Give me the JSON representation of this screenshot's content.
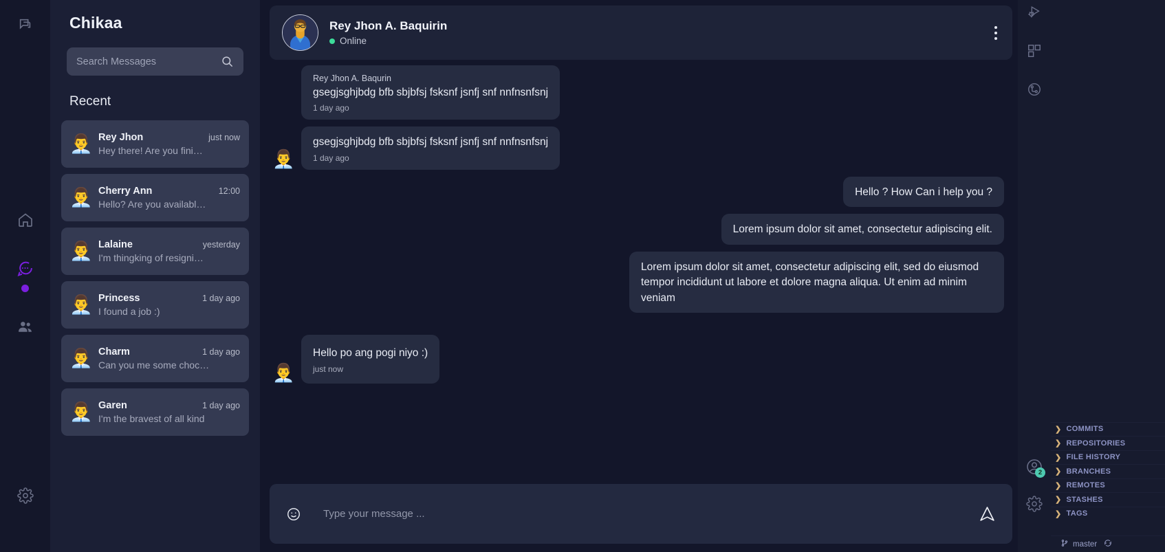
{
  "app": {
    "brand": "Chikaa"
  },
  "rail": {
    "items": [
      {
        "name": "messages-rail-icon",
        "label": "Messages"
      },
      {
        "name": "home-rail-icon",
        "label": "Home"
      },
      {
        "name": "chat-rail-icon",
        "label": "Chat"
      },
      {
        "name": "contacts-rail-icon",
        "label": "Contacts"
      },
      {
        "name": "settings-rail-icon",
        "label": "Settings"
      }
    ]
  },
  "search": {
    "placeholder": "Search Messages",
    "value": ""
  },
  "sidebar": {
    "section_title": "Recent",
    "chats": [
      {
        "name": "Rey Jhon",
        "time": "just now",
        "preview": "Hey there! Are you fini…",
        "avatar": "👨‍💼"
      },
      {
        "name": "Cherry Ann",
        "time": "12:00",
        "preview": "Hello? Are you availabl…",
        "avatar": "👨‍💼"
      },
      {
        "name": "Lalaine",
        "time": "yesterday",
        "preview": "I'm thingking of resigni…",
        "avatar": "👨‍💼"
      },
      {
        "name": "Princess",
        "time": "1 day ago",
        "preview": "I found a job :)",
        "avatar": "👨‍💼"
      },
      {
        "name": "Charm",
        "time": "1 day ago",
        "preview": "Can you me some choc…",
        "avatar": "👨‍💼"
      },
      {
        "name": "Garen",
        "time": "1 day ago",
        "preview": "I'm the bravest of all kind",
        "avatar": "👨‍💼"
      }
    ]
  },
  "conversation": {
    "header": {
      "name": "Rey Jhon A. Baquirin",
      "status": "Online",
      "status_color": "#3ddc9a"
    },
    "messages": [
      {
        "side": "in",
        "sender": "Rey Jhon A. Baqurin",
        "text": "gsegjsghjbdg bfb sbjbfsj fsksnf jsnfj snf nnfnsnfsnj",
        "time": "1 day ago",
        "show_avatar": false
      },
      {
        "side": "in",
        "sender": "",
        "text": "gsegjsghjbdg bfb sbjbfsj fsksnf jsnfj snf nnfnsnfsnj",
        "time": "1 day ago",
        "show_avatar": true
      },
      {
        "side": "out",
        "sender": "",
        "text": "Hello ? How Can i help you ?",
        "time": "",
        "show_avatar": false
      },
      {
        "side": "out",
        "sender": "",
        "text": "Lorem ipsum dolor sit amet, consectetur adipiscing elit.",
        "time": "",
        "show_avatar": false
      },
      {
        "side": "out",
        "sender": "",
        "text": "Lorem ipsum dolor sit amet, consectetur adipiscing elit, sed do eiusmod tempor incididunt ut labore et dolore magna aliqua. Ut enim ad minim veniam",
        "time": "",
        "show_avatar": false
      },
      {
        "side": "in",
        "sender": "",
        "text": "Hello po ang pogi niyo :)",
        "time": "just now",
        "show_avatar": true
      }
    ]
  },
  "composer": {
    "placeholder": "Type your message ...",
    "value": ""
  },
  "ide": {
    "activity_icons": [
      "run-and-debug-icon",
      "extensions-icon",
      "source-control-icon"
    ],
    "account_badge": "2",
    "scm_sections": [
      "COMMITS",
      "REPOSITORIES",
      "FILE HISTORY",
      "BRANCHES",
      "REMOTES",
      "STASHES",
      "TAGS"
    ],
    "status_branch": "master"
  }
}
